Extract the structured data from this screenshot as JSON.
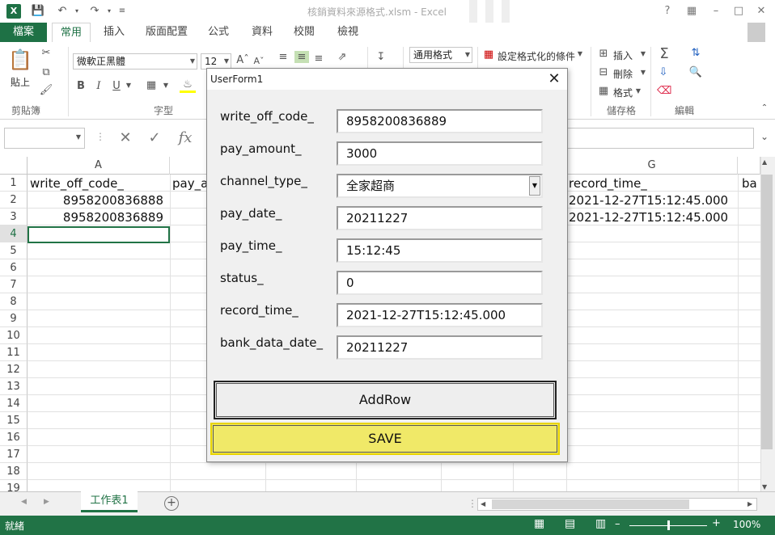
{
  "window": {
    "title": "核銷資料來源格式.xlsm - Excel",
    "app_logo": "X",
    "help": "?",
    "accent": "#217346"
  },
  "ribbon": {
    "file_tab": "檔案",
    "tabs": [
      "常用",
      "插入",
      "版面配置",
      "公式",
      "資料",
      "校閱",
      "檢視"
    ],
    "active_tab": "常用",
    "clipboard": {
      "paste_label": "貼上",
      "group_label": "剪貼簿"
    },
    "font": {
      "name": "微軟正黑體",
      "size": "12",
      "group_label": "字型",
      "bold": "B",
      "italic": "I",
      "underline": "U"
    },
    "number": {
      "format": "通用格式"
    },
    "styles": {
      "conditional": "設定格式化的條件"
    },
    "cells": {
      "insert": "插入",
      "delete": "刪除",
      "format": "格式",
      "group_label": "儲存格"
    },
    "editing": {
      "group_label": "編輯"
    }
  },
  "formula_bar": {
    "name_box": "",
    "fx": "fx",
    "value": ""
  },
  "grid": {
    "columns_visible": [
      "A",
      "G"
    ],
    "rows": [
      "1",
      "2",
      "3",
      "4",
      "5",
      "6",
      "7",
      "8",
      "9",
      "10",
      "11",
      "12",
      "13",
      "14",
      "15",
      "16",
      "17",
      "18",
      "19"
    ],
    "selected_row": "4",
    "cells": {
      "A1": "write_off_code_",
      "B1": "pay_a",
      "G1": "record_time_",
      "H1": "ba",
      "A2": "8958200836888",
      "G2": "2021-12-27T15:12:45.000",
      "A3": "8958200836889",
      "G3": "2021-12-27T15:12:45.000"
    }
  },
  "sheets": {
    "tabs": [
      "工作表1"
    ],
    "add": "+"
  },
  "status_bar": {
    "text": "就緒",
    "zoom": "100%"
  },
  "userform": {
    "title": "UserForm1",
    "fields": [
      {
        "label": "write_off_code_",
        "value": "8958200836889"
      },
      {
        "label": "pay_amount_",
        "value": "3000"
      },
      {
        "label": "channel_type_",
        "value": "全家超商"
      },
      {
        "label": "pay_date_",
        "value": "20211227"
      },
      {
        "label": "pay_time_",
        "value": "15:12:45"
      },
      {
        "label": "status_",
        "value": "0"
      },
      {
        "label": "record_time_",
        "value": "2021-12-27T15:12:45.000"
      },
      {
        "label": "bank_data_date_",
        "value": "20211227"
      }
    ],
    "add_button": "AddRow",
    "save_button": "SAVE",
    "save_color": "#f0e968"
  }
}
